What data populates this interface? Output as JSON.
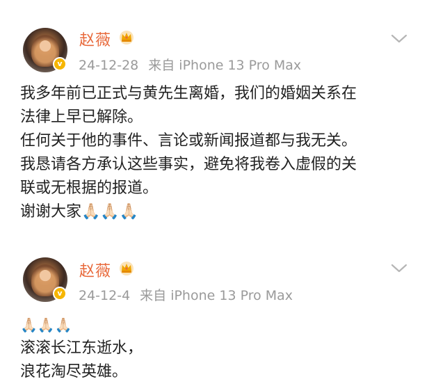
{
  "posts": [
    {
      "author": "赵薇",
      "date": "24-12-28",
      "source": "来自 iPhone 13 Pro Max",
      "lines": [
        "我多年前已正式与黄先生离婚，我们的婚姻关系在",
        "法律上早已解除。",
        "任何关于他的事件、言论或新闻报道都与我无关。",
        "我恳请各方承认这些事实，避免将我卷入虚假的关",
        "联或无根据的报道。",
        "谢谢大家🙏🏻🙏🏻🙏🏻"
      ]
    },
    {
      "author": "赵薇",
      "date": "24-12-4",
      "source": "来自 iPhone 13 Pro Max",
      "lines": [
        "🙏🏻🙏🏻🙏🏻",
        "滚滚长江东逝水，",
        "浪花淘尽英雄。"
      ]
    }
  ],
  "icons": {
    "vip": "crown-icon",
    "verified": "verified-badge-icon",
    "expand": "chevron-down-icon"
  },
  "colors": {
    "author_name": "#e8693b",
    "meta_text": "#9a9a9a",
    "body_text": "#222222",
    "verified_badge": "#f6b600",
    "crown": "#f0a500"
  }
}
